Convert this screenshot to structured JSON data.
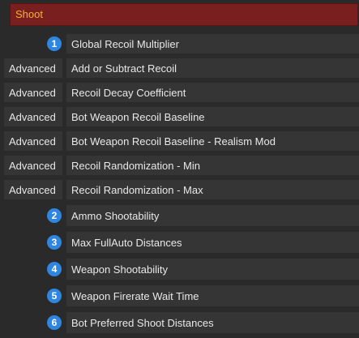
{
  "section": {
    "title": "Shoot"
  },
  "rows": [
    {
      "badge": "1",
      "label": "Global Recoil Multiplier"
    },
    {
      "prefix": "Advanced",
      "label": "Add or Subtract Recoil"
    },
    {
      "prefix": "Advanced",
      "label": "Recoil Decay Coefficient"
    },
    {
      "prefix": "Advanced",
      "label": "Bot Weapon Recoil Baseline"
    },
    {
      "prefix": "Advanced",
      "label": "Bot Weapon Recoil Baseline - Realism Mod"
    },
    {
      "prefix": "Advanced",
      "label": "Recoil Randomization - Min"
    },
    {
      "prefix": "Advanced",
      "label": "Recoil Randomization - Max"
    },
    {
      "badge": "2",
      "label": "Ammo Shootability"
    },
    {
      "badge": "3",
      "label": "Max FullAuto Distances"
    },
    {
      "badge": "4",
      "label": "Weapon Shootability"
    },
    {
      "badge": "5",
      "label": "Weapon Firerate Wait Time"
    },
    {
      "badge": "6",
      "label": "Bot Preferred Shoot Distances"
    }
  ],
  "colors": {
    "header_bg": "#7a1f1f",
    "header_text": "#f2b233",
    "row_bg": "#353535",
    "badge_bg": "#2f86e0",
    "panel_bg": "#2a2a2a"
  }
}
